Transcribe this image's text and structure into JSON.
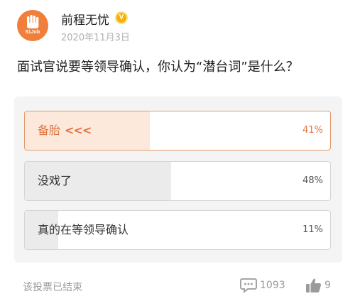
{
  "post": {
    "avatar_text": "51Job",
    "author": "前程无忧",
    "verified_mark": "V",
    "date": "2020年11月3日",
    "question": "面试官说要等领导确认，你认为“潜台词”是什么？"
  },
  "poll": {
    "options": [
      {
        "label": "备胎",
        "marker": "<<<",
        "percent": "41%",
        "fill": 0.41,
        "selected": true
      },
      {
        "label": "没戏了",
        "marker": "",
        "percent": "48%",
        "fill": 0.48,
        "selected": false
      },
      {
        "label": "真的在等领导确认",
        "marker": "",
        "percent": "11%",
        "fill": 0.11,
        "selected": false
      }
    ]
  },
  "footer": {
    "status": "该投票已结束",
    "comment_count": "1093",
    "like_count": "9"
  },
  "colors": {
    "brand_orange": "#ef7f3a",
    "selected_text": "#e0743f",
    "selected_fill": "#fce9dc",
    "verified_gold": "#f5b400"
  },
  "icons": [
    "hand-logo-icon",
    "verified-icon",
    "comment-icon",
    "thumbs-up-icon"
  ]
}
